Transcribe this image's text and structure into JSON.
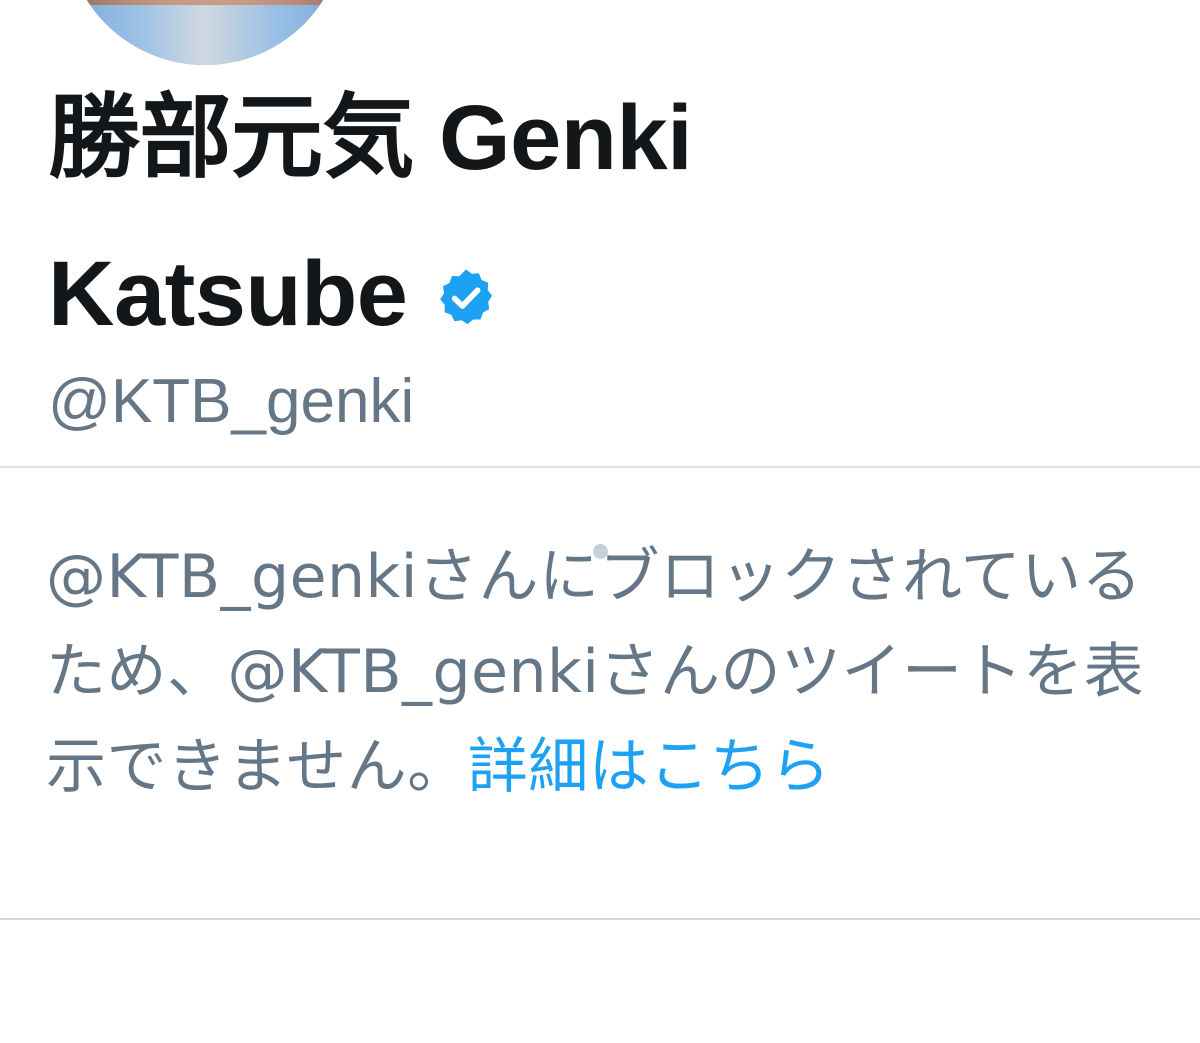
{
  "profile": {
    "display_name": "勝部元気 Genki Katsube",
    "handle": "@KTB_genki",
    "verified": true,
    "verified_icon": "verified-badge-icon",
    "accent_color": "#1da1f2"
  },
  "blocked_notice": {
    "message": "@KTB_genkiさんにブロックされているため、@KTB_genkiさんのツイートを表示できません。",
    "learn_more_link": "詳細はこちら"
  }
}
